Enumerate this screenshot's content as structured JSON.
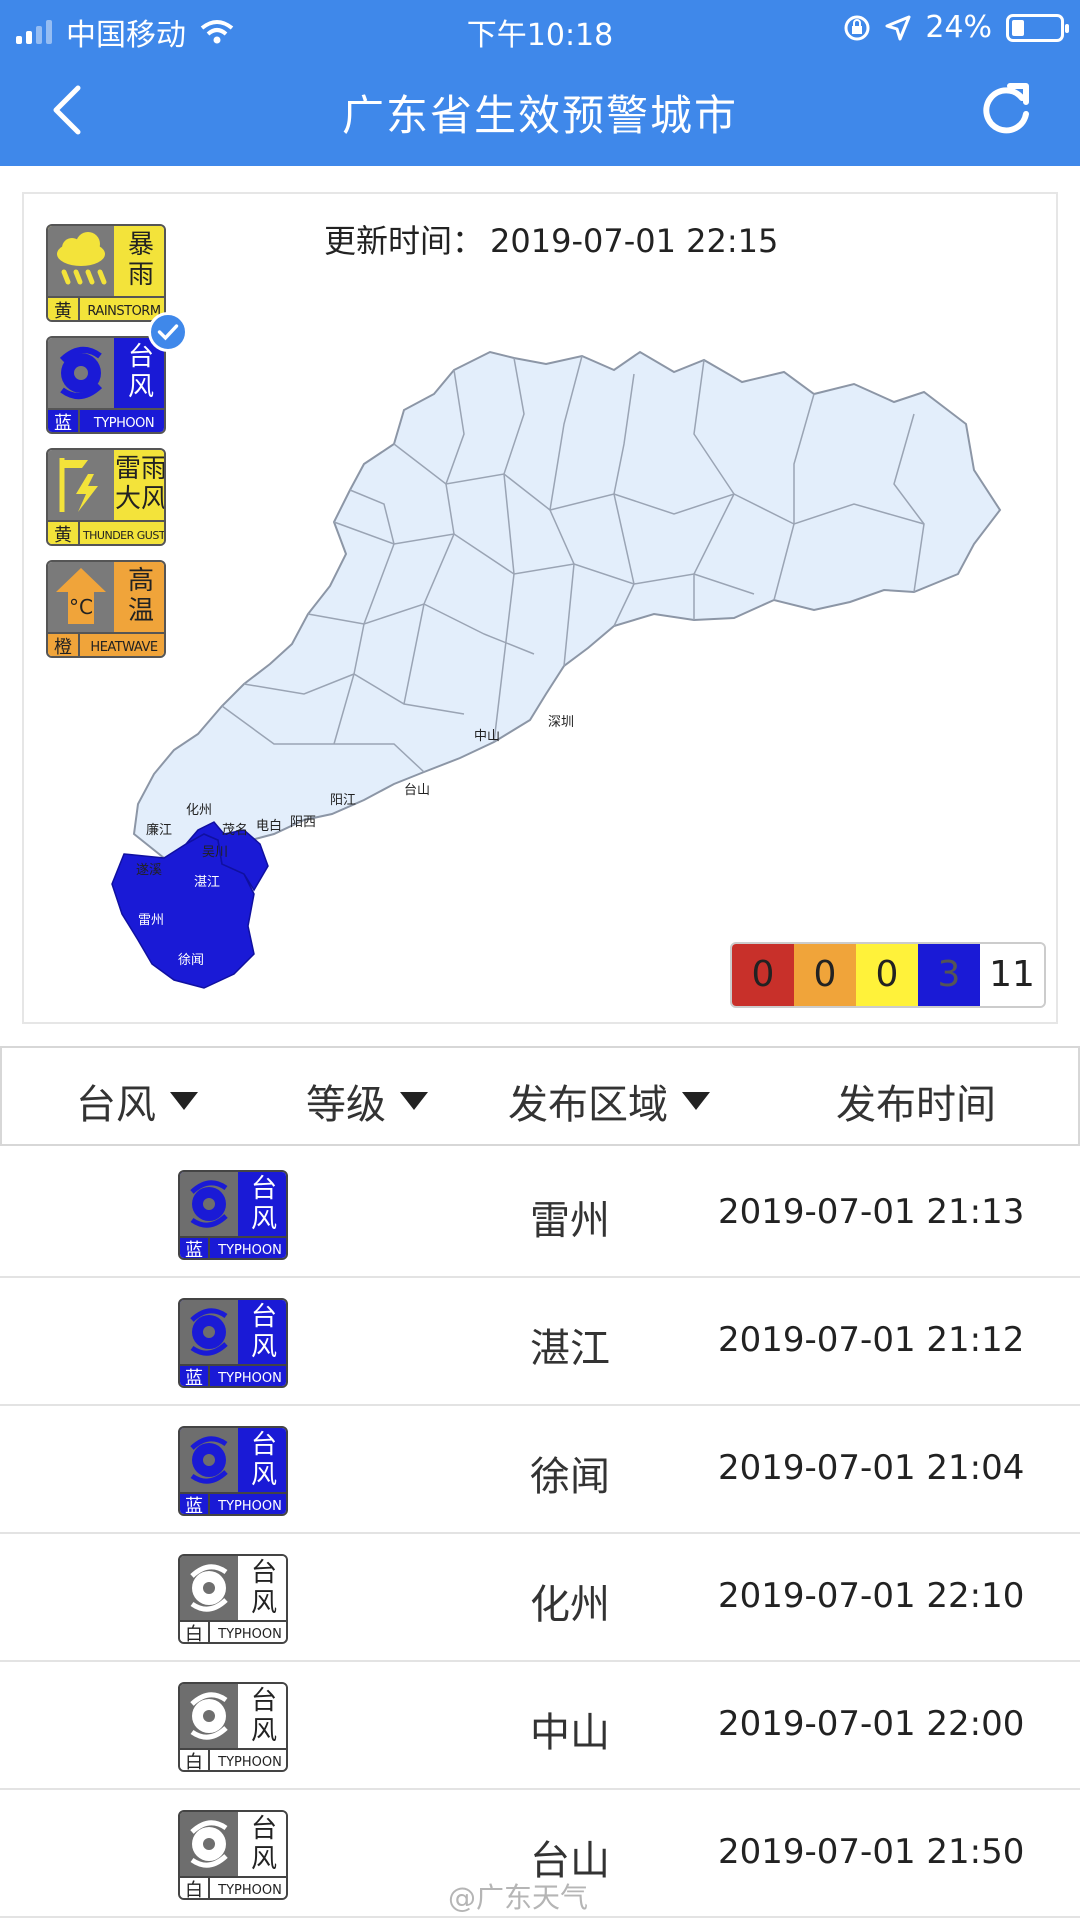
{
  "status_bar": {
    "carrier": "中国移动",
    "time": "下午10:18",
    "battery": "24%",
    "battery_fraction": 0.24
  },
  "nav": {
    "title": "广东省生效预警城市"
  },
  "map": {
    "update_label": "更新时间：",
    "update_value": "2019-07-01 22:15",
    "legend": [
      {
        "word": "暴\n雨",
        "level": "黄",
        "en": "RAINSTORM",
        "color": "#f3e33a",
        "icon": "rainstorm-icon"
      },
      {
        "word": "台\n风",
        "level": "蓝",
        "en": "TYPHOON",
        "color": "#1a1ad6",
        "icon": "typhoon-icon"
      },
      {
        "word": "雷雨\n大风",
        "level": "黄",
        "en": "THUNDER GUST",
        "color": "#f3e33a",
        "icon": "thunder-gust-icon"
      },
      {
        "word": "高\n温",
        "level": "橙",
        "en": "HEATWAVE",
        "color": "#f0a43a",
        "icon": "heatwave-icon"
      }
    ],
    "city_labels": [
      "中山",
      "深圳",
      "台山",
      "阳江",
      "阳西",
      "电白",
      "茂名",
      "化州",
      "廉江",
      "吴川",
      "遂溪",
      "湛江",
      "雷州",
      "徐闻"
    ],
    "counts": [
      {
        "value": "0",
        "color": "#c8302a"
      },
      {
        "value": "0",
        "color": "#f0a43a"
      },
      {
        "value": "0",
        "color": "#fff23a"
      },
      {
        "value": "3",
        "color": "#1a1ad6"
      },
      {
        "value": "11",
        "color": "#ffffff"
      }
    ]
  },
  "table": {
    "headers": {
      "type": "台风",
      "level": "等级",
      "area": "发布区域",
      "time": "发布时间"
    },
    "rows": [
      {
        "level": "蓝",
        "word": "台\n风",
        "en": "TYPHOON",
        "area": "雷州",
        "time": "2019-07-01 21:13",
        "style": "blue"
      },
      {
        "level": "蓝",
        "word": "台\n风",
        "en": "TYPHOON",
        "area": "湛江",
        "time": "2019-07-01 21:12",
        "style": "blue"
      },
      {
        "level": "蓝",
        "word": "台\n风",
        "en": "TYPHOON",
        "area": "徐闻",
        "time": "2019-07-01 21:04",
        "style": "blue"
      },
      {
        "level": "白",
        "word": "台\n风",
        "en": "TYPHOON",
        "area": "化州",
        "time": "2019-07-01 22:10",
        "style": "white"
      },
      {
        "level": "白",
        "word": "台\n风",
        "en": "TYPHOON",
        "area": "中山",
        "time": "2019-07-01 22:00",
        "style": "white"
      },
      {
        "level": "白",
        "word": "台\n风",
        "en": "TYPHOON",
        "area": "台山",
        "time": "2019-07-01 21:50",
        "style": "white"
      }
    ]
  },
  "watermark": "@广东天气"
}
